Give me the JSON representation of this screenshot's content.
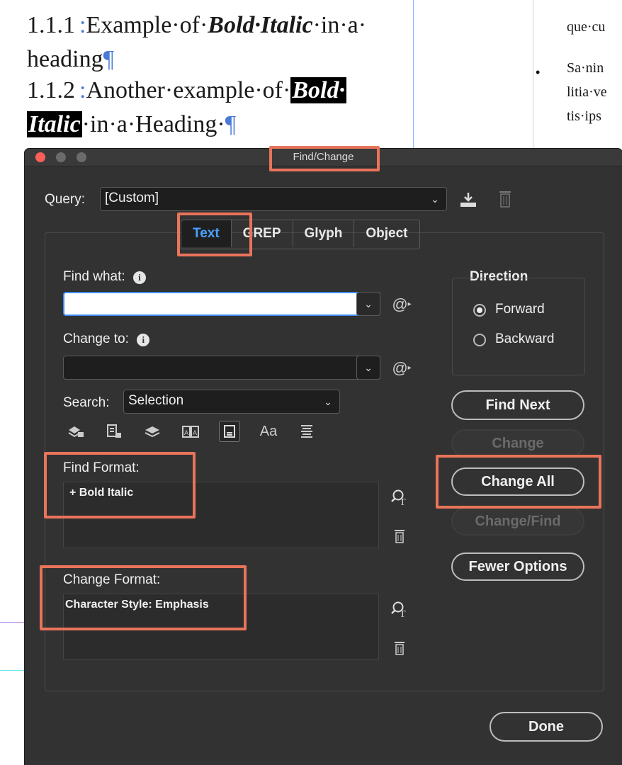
{
  "document": {
    "heading1": {
      "number": "1.1.1",
      "pre": "Example·of·",
      "bold_italic": "Bold·Italic",
      "post": "·in·a·",
      "line2": "heading",
      "pilcrow": "¶"
    },
    "heading2": {
      "number": "1.1.2",
      "pre": "Another·example·of·",
      "hl1": "Bold·",
      "hl2": "Italic",
      "post": "·in·a·Heading·",
      "pilcrow": "¶"
    },
    "right_column": {
      "line1": "que·cu",
      "line2": "Sa·nin",
      "line3": "litia·ve",
      "line4": "tis·ips"
    }
  },
  "dialog": {
    "title": "Find/Change",
    "query_label": "Query:",
    "query_value": "[Custom]",
    "tabs": [
      "Text",
      "GREP",
      "Glyph",
      "Object"
    ],
    "active_tab": "Text",
    "find_what_label": "Find what:",
    "find_what_value": "",
    "change_to_label": "Change to:",
    "change_to_value": "",
    "search_label": "Search:",
    "search_value": "Selection",
    "direction_label": "Direction",
    "direction_options": [
      "Forward",
      "Backward"
    ],
    "direction_selected": "Forward",
    "buttons": {
      "find_next": "Find Next",
      "change": "Change",
      "change_all": "Change All",
      "change_find": "Change/Find",
      "fewer_options": "Fewer Options",
      "done": "Done"
    },
    "find_format_label": "Find Format:",
    "find_format_value": "+ Bold Italic",
    "change_format_label": "Change Format:",
    "change_format_value": "Character Style: Emphasis",
    "case_icon_text": "Aa",
    "highlight_color": "#e9745a",
    "accent_color": "#4aa2ff"
  }
}
